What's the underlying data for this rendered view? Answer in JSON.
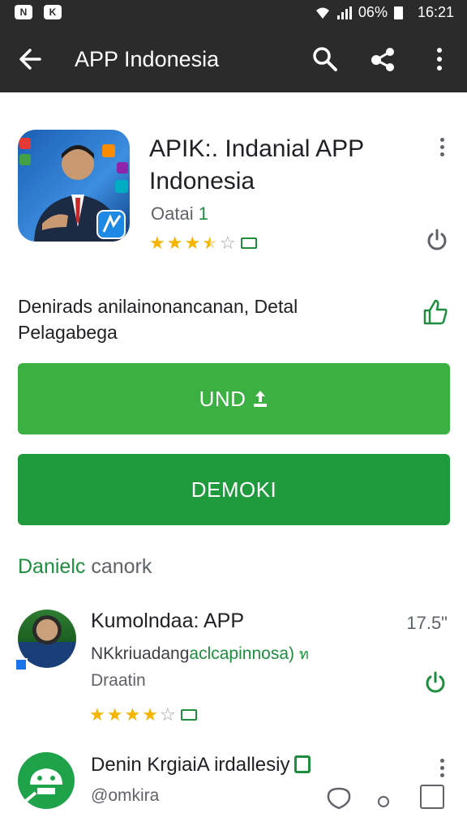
{
  "status_bar": {
    "battery": "06%",
    "time": "16:21"
  },
  "app_bar": {
    "title": "APP Indonesia"
  },
  "app": {
    "name": "APIK:. Indanial APP Indonesia",
    "developer_prefix": "Oatai ",
    "developer_suffix": "1",
    "rating_stars": 3.5,
    "description": "Denirads anilainonancanan, Detal Pelagabega"
  },
  "buttons": {
    "install": "UND",
    "demo": "DEMOKI"
  },
  "section": {
    "title_accent": "Danielc",
    "title_rest": " canork"
  },
  "list": [
    {
      "title": "Kumolndaa: APP",
      "size": "17.5\"",
      "subtitle_prefix": "NKkriuadang",
      "subtitle_accent": "aclcapinnosa)",
      "subtitle_glyph": "ท",
      "meta": "Draatin",
      "rating_stars": 4
    },
    {
      "title": "Denin KrgiaiA irdallesiy",
      "subtitle": "@omkira"
    }
  ],
  "colors": {
    "bar": "#2b2b2b",
    "install": "#3cb043",
    "demo": "#1f9a3c",
    "accent": "#1e8e3e",
    "star": "#f4b400"
  },
  "icons": [
    "back-arrow-icon",
    "search-icon",
    "share-icon",
    "more-vert-icon",
    "thumb-up-icon",
    "power-icon",
    "upload-icon"
  ]
}
